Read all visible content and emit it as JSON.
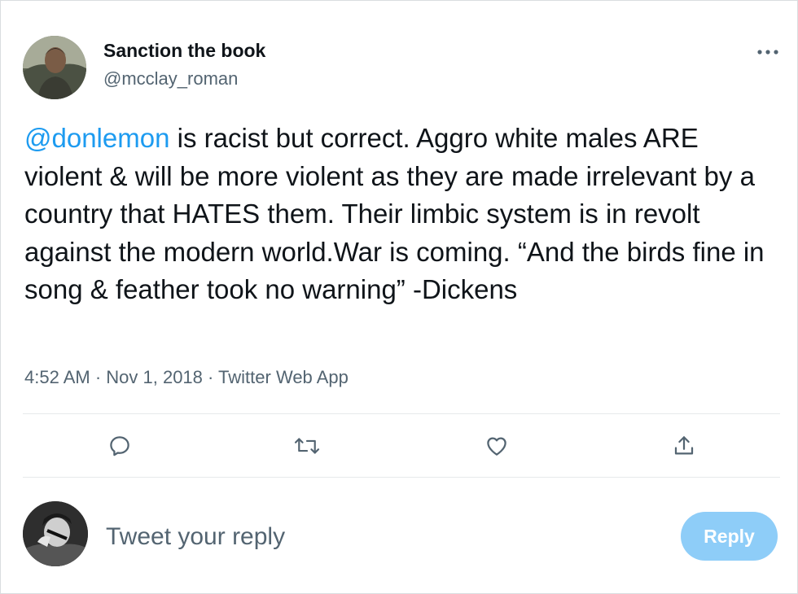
{
  "author": {
    "display_name": "Sanction the book",
    "handle": "@mcclay_roman"
  },
  "tweet": {
    "mention": "@donlemon",
    "text": " is racist but correct. Aggro white males ARE violent & will be more violent as they are made irrelevant by a country that HATES them. Their limbic system is in revolt against the modern world.War is coming. “And the birds fine in song & feather took no warning” -Dickens",
    "timestamp": "4:52 AM · Nov 1, 2018 · Twitter Web App"
  },
  "actions": {
    "icons": [
      "reply-icon",
      "retweet-icon",
      "like-icon",
      "share-icon"
    ]
  },
  "reply_box": {
    "placeholder": "Tweet your reply",
    "button_label": "Reply"
  },
  "colors": {
    "mention": "#1d9bf0",
    "reply_button": "#8ecdf8",
    "secondary_text": "#536471",
    "icon": "#536471"
  }
}
